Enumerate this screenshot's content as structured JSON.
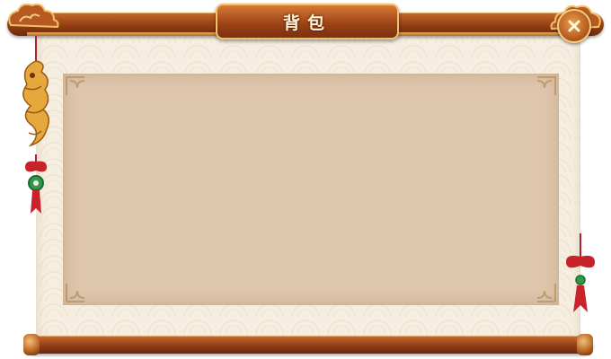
{
  "window": {
    "title": "背包"
  },
  "icons": {
    "close": "close-icon",
    "dragon": "dragon-icon",
    "tassel": "tassel-icon",
    "corner": "corner-ornament-icon"
  },
  "colors": {
    "rod_primary": "#9a4115",
    "rod_highlight": "#e6a95a",
    "paper": "#f6efe1",
    "content_panel": "#dfc7ad",
    "title_text": "#fff2d6",
    "tassel_red": "#c8222a",
    "jade_green": "#2f9a4a"
  }
}
